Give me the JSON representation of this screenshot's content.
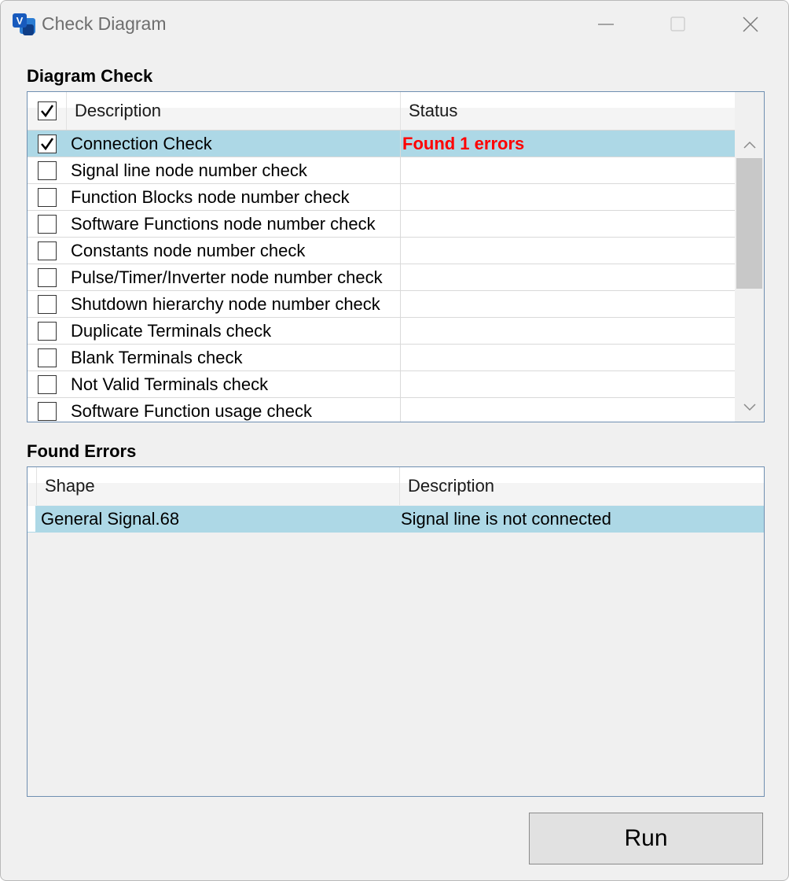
{
  "window": {
    "title": "Check Diagram"
  },
  "diagram_check": {
    "label": "Diagram Check",
    "columns": {
      "description": "Description",
      "status": "Status"
    },
    "header_checked": true,
    "rows": [
      {
        "label": "Connection Check",
        "status": "Found 1 errors",
        "checked": true,
        "selected": true
      },
      {
        "label": "Signal line node number check",
        "status": "",
        "checked": false
      },
      {
        "label": "Function Blocks node number check",
        "status": "",
        "checked": false
      },
      {
        "label": "Software Functions node number check",
        "status": "",
        "checked": false
      },
      {
        "label": "Constants node number check",
        "status": "",
        "checked": false
      },
      {
        "label": "Pulse/Timer/Inverter node number check",
        "status": "",
        "checked": false
      },
      {
        "label": "Shutdown hierarchy node number check",
        "status": "",
        "checked": false
      },
      {
        "label": "Duplicate Terminals check",
        "status": "",
        "checked": false
      },
      {
        "label": "Blank Terminals check",
        "status": "",
        "checked": false
      },
      {
        "label": "Not Valid Terminals check",
        "status": "",
        "checked": false
      },
      {
        "label": "Software Function usage check",
        "status": "",
        "checked": false
      }
    ]
  },
  "found_errors": {
    "label": "Found Errors",
    "columns": {
      "shape": "Shape",
      "description": "Description"
    },
    "rows": [
      {
        "shape": "General Signal.68",
        "description": "Signal line is not connected"
      }
    ]
  },
  "actions": {
    "run": "Run"
  },
  "colors": {
    "selection": "#add8e6",
    "status_error": "#ff0000",
    "grid_border": "#6f8fb1",
    "app_icon": "#185abd"
  },
  "icons": {
    "app": "visio-app-icon",
    "minimize": "minimize-icon",
    "maximize": "maximize-icon",
    "close": "close-icon"
  }
}
